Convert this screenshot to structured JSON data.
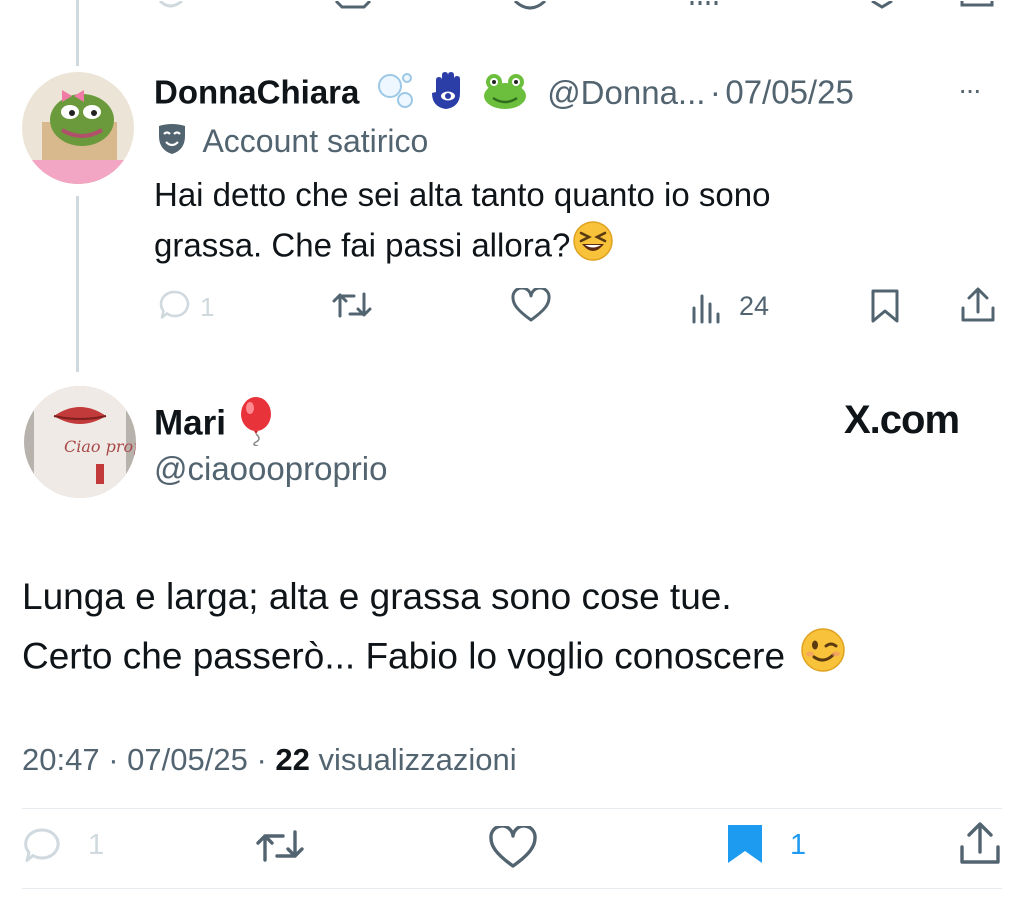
{
  "reply_tweet": {
    "display_name": "DonnaChiara",
    "handle": "@Donna...",
    "date_sep": "·",
    "date": "07/05/25",
    "more_label": "···",
    "label_text": "Account satirico",
    "text_line1": "Hai detto che sei alta tanto quanto io sono",
    "text_line2": "grassa. Che fai passi allora?",
    "reply_count": "1",
    "views_count": "24"
  },
  "main_tweet": {
    "display_name": "Mari",
    "handle": "@ciaoooproprio",
    "watermark": "X.com",
    "avatar_text": "Ciao proprio",
    "text_line1": "Lunga e larga; alta e grassa sono cose tue.",
    "text_line2": "Certo che passerò... Fabio lo voglio conoscere",
    "time": "20:47",
    "sep1": "·",
    "date": "07/05/25",
    "sep2": "·",
    "views_count": "22",
    "views_label": "visualizzazioni",
    "reply_count": "1",
    "bookmark_count": "1"
  },
  "colors": {
    "text": "#0f1419",
    "secondary": "#536471",
    "bookmark_active": "#1d9bf0",
    "thread_line": "#cfd9de"
  },
  "icons": [
    "reply-icon",
    "retweet-icon",
    "like-icon",
    "views-icon",
    "bookmark-icon",
    "share-icon",
    "parody-mask-icon",
    "bubbles-icon",
    "hamsa-icon",
    "frog-icon",
    "balloon-icon",
    "laughing-emoji-icon",
    "wink-emoji-icon",
    "more-icon"
  ]
}
